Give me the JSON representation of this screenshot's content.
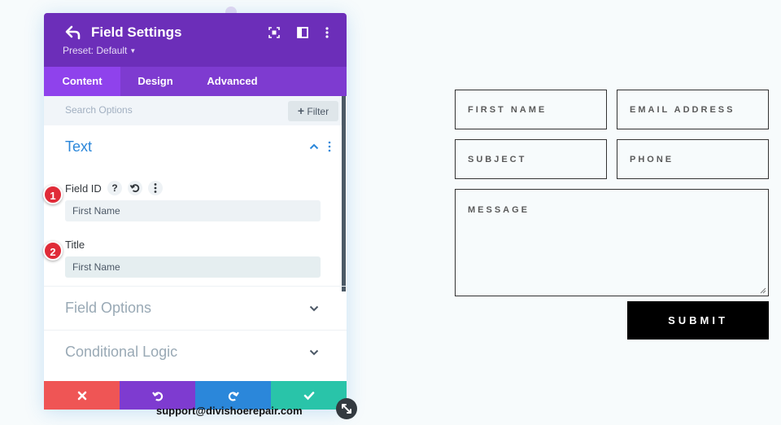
{
  "panel": {
    "title": "Field Settings",
    "preset": "Preset: Default",
    "tabs": [
      {
        "label": "Content",
        "active": true
      },
      {
        "label": "Design",
        "active": false
      },
      {
        "label": "Advanced",
        "active": false
      }
    ],
    "search": {
      "placeholder": "Search Options"
    },
    "filter_label": "Filter",
    "sections": {
      "text": {
        "title": "Text",
        "field_id_label": "Field ID",
        "field_id_value": "First Name",
        "title_label": "Title",
        "title_value": "First Name"
      },
      "field_options": "Field Options",
      "conditional_logic": "Conditional Logic"
    },
    "badges": [
      "1",
      "2"
    ]
  },
  "footer_email": "support@divishoerepair.com",
  "form": {
    "first_name": "FIRST NAME",
    "email": "EMAIL ADDRESS",
    "subject": "SUBJECT",
    "phone": "PHONE",
    "message": "MESSAGE",
    "submit": "SUBMIT"
  },
  "colors": {
    "header": "#6c2eb9",
    "tabs": "#7e3bd0",
    "accent_blue": "#2b87da",
    "cancel": "#ef5555",
    "undo": "#7e3bd0",
    "redo": "#2b87da",
    "save": "#29c4a9"
  },
  "icons": [
    "undo-arrow-icon",
    "fullscreen-icon",
    "split-view-icon",
    "kebab-menu-icon",
    "plus-icon",
    "chevron-up-icon",
    "chevron-down-icon",
    "help-icon",
    "reset-icon",
    "close-icon",
    "check-icon",
    "resize-icon"
  ]
}
